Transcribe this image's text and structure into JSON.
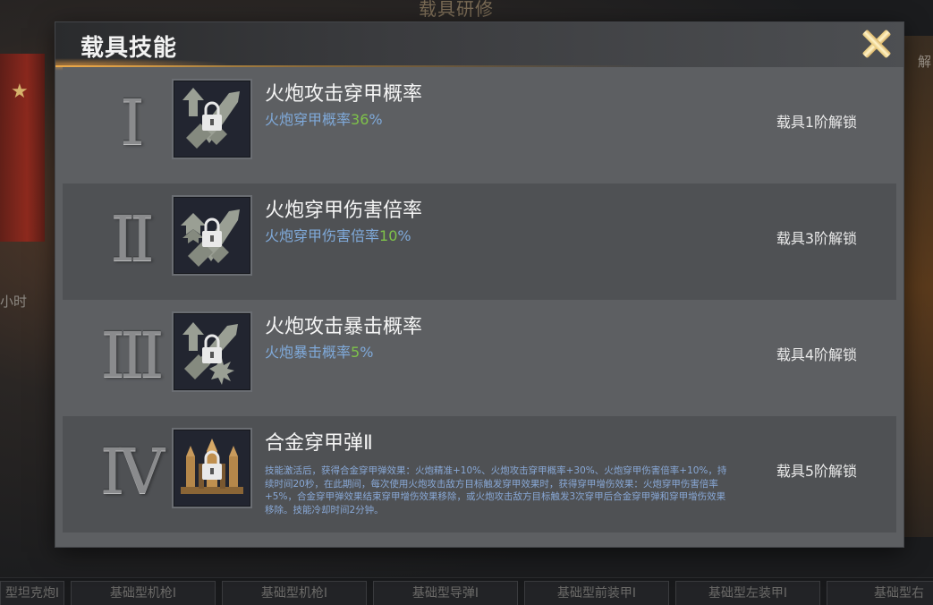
{
  "background": {
    "title": "载具研修",
    "right_label": "解",
    "left_label": "小时",
    "bottom_tabs": [
      "型坦克炮I",
      "基础型机枪I",
      "基础型机枪I",
      "基础型导弹I",
      "基础型前装甲I",
      "基础型左装甲I",
      "基础型右"
    ]
  },
  "modal": {
    "title": "载具技能",
    "close_icon": "close-x-icon"
  },
  "skills": [
    {
      "numeral": "I",
      "icon": "cannon-armor-pierce-up-icon",
      "name": "火炮攻击穿甲概率",
      "desc_prefix": "火炮穿甲概率",
      "desc_value": "36",
      "desc_suffix": "%",
      "unlock": "载具1阶解锁"
    },
    {
      "numeral": "II",
      "icon": "cannon-pierce-damage-icon",
      "name": "火炮穿甲伤害倍率",
      "desc_prefix": "火炮穿甲伤害倍率",
      "desc_value": "10",
      "desc_suffix": "%",
      "unlock": "载具3阶解锁"
    },
    {
      "numeral": "III",
      "icon": "cannon-critical-up-icon",
      "name": "火炮攻击暴击概率",
      "desc_prefix": "火炮暴击概率",
      "desc_value": "5",
      "desc_suffix": "%",
      "unlock": "载具4阶解锁"
    },
    {
      "numeral": "IV",
      "icon": "alloy-shell-icon",
      "name": "合金穿甲弹Ⅱ",
      "long_desc": "技能激活后，获得合金穿甲弹效果：火炮精准+10%、火炮攻击穿甲概率+30%、火炮穿甲伤害倍率+10%，持续时间20秒，在此期间，每次使用火炮攻击敌方目标触发穿甲效果时，获得穿甲增伤效果：火炮穿甲伤害倍率+5%，合金穿甲弹效果结束穿甲增伤效果移除，或火炮攻击敌方目标触发3次穿甲后合金穿甲弹和穿甲增伤效果移除。技能冷却时间2分钟。",
      "unlock": "载具5阶解锁"
    }
  ],
  "colors": {
    "accent_gold": "#e7c878",
    "desc_blue": "#7fa9d9",
    "value_green": "#7ec24a"
  }
}
